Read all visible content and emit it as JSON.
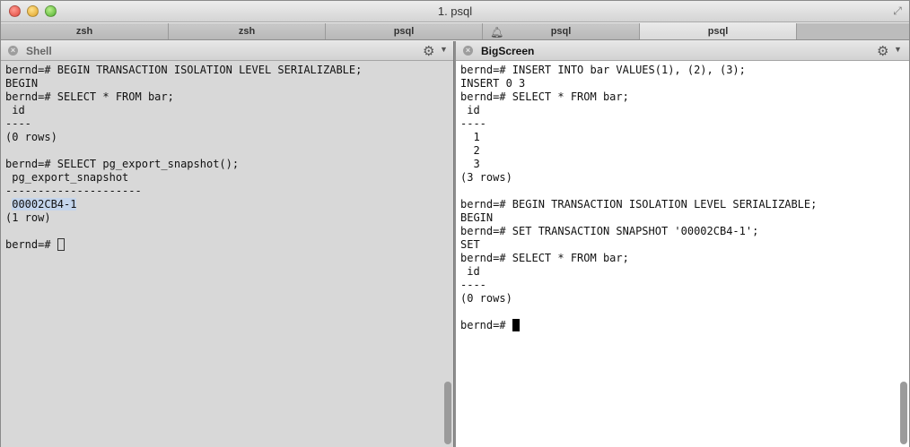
{
  "window": {
    "title": "1. psql"
  },
  "tabs": [
    {
      "label": "zsh",
      "active": false
    },
    {
      "label": "zsh",
      "active": false
    },
    {
      "label": "psql",
      "active": false
    },
    {
      "label": "psql",
      "active": false,
      "icon": "bell-icon"
    },
    {
      "label": "psql",
      "active": true
    }
  ],
  "left_pane": {
    "title": "Shell",
    "lines": [
      "bernd=# BEGIN TRANSACTION ISOLATION LEVEL SERIALIZABLE;",
      "BEGIN",
      "bernd=# SELECT * FROM bar;",
      " id",
      "----",
      "(0 rows)",
      "",
      "bernd=# SELECT pg_export_snapshot();",
      " pg_export_snapshot",
      "---------------------",
      "00002CB4-1",
      "(1 row)",
      "",
      "bernd=# "
    ]
  },
  "right_pane": {
    "title": "BigScreen",
    "lines": [
      "bernd=# INSERT INTO bar VALUES(1), (2), (3);",
      "INSERT 0 3",
      "bernd=# SELECT * FROM bar;",
      " id",
      "----",
      "  1",
      "  2",
      "  3",
      "(3 rows)",
      "",
      "bernd=# BEGIN TRANSACTION ISOLATION LEVEL SERIALIZABLE;",
      "BEGIN",
      "bernd=# SET TRANSACTION SNAPSHOT '00002CB4-1';",
      "SET",
      "bernd=# SELECT * FROM bar;",
      " id",
      "----",
      "(0 rows)",
      "",
      "bernd=# "
    ]
  },
  "colors": {
    "left_background": "#d8d8d8",
    "right_background": "#ffffff",
    "selection": "#c4d5ec"
  }
}
